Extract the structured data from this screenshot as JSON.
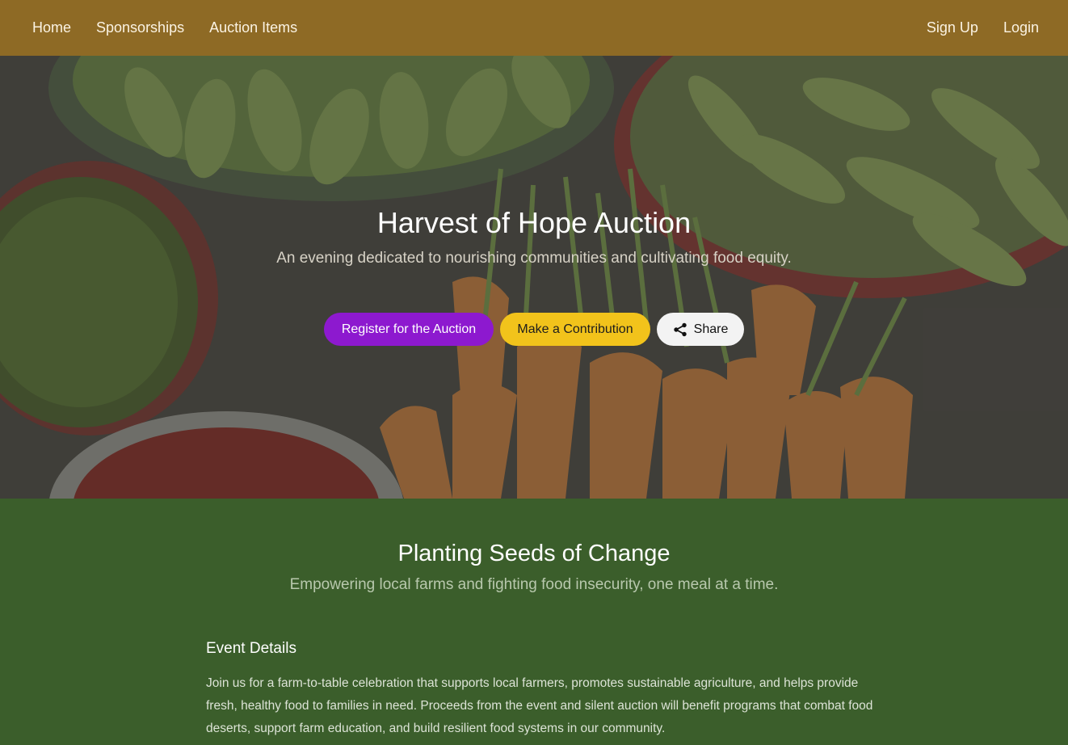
{
  "nav": {
    "left_links": [
      "Home",
      "Sponsorships",
      "Auction Items"
    ],
    "right_links": [
      "Sign Up",
      "Login"
    ]
  },
  "hero": {
    "title": "Harvest of Hope Auction",
    "subtitle": "An evening dedicated to nourishing communities and cultivating food equity.",
    "buttons": {
      "register": "Register for the Auction",
      "contribute": "Make a Contribution",
      "share": "Share"
    },
    "share_icon": "share-icon"
  },
  "section": {
    "title": "Planting Seeds of Change",
    "subtitle": "Empowering local farms and fighting food insecurity, one meal at a time."
  },
  "details": {
    "heading": "Event Details",
    "body": "Join us for a farm-to-table celebration that supports local farmers, promotes sustainable agriculture, and helps provide fresh, healthy food to families in need. Proceeds from the event and silent auction will benefit programs that combat food deserts, support farm education, and build resilient food systems in our community."
  },
  "colors": {
    "nav_bg": "#8e6a25",
    "register_button": "#8d19cf",
    "contribute_button": "#f2c31b",
    "share_button": "#f3f3f3",
    "section_bg": "#3b5e2b"
  }
}
